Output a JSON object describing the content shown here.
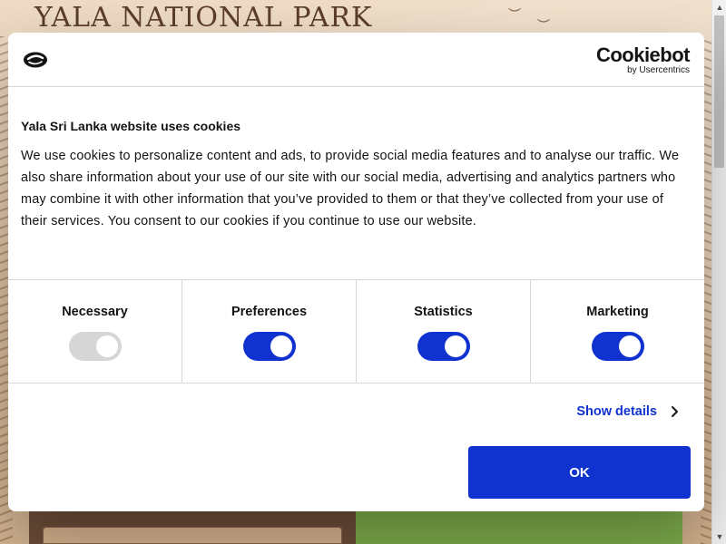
{
  "background": {
    "site_title": "YALA NATIONAL PARK"
  },
  "dialog": {
    "brand": {
      "name": "Cookiebot",
      "byline": "by Usercentrics"
    },
    "title": "Yala Sri Lanka website uses cookies",
    "body": "We use cookies to personalize content and ads, to provide social media features and to analyse our traffic. We also share information about your use of our site with our social media, advertising and analytics partners who may combine it with other information that you’ve provided to them or that they’ve collected from your use of their services. You consent to our cookies if you continue to use our website.",
    "categories": [
      {
        "label": "Necessary",
        "enabled": true,
        "disabled": true
      },
      {
        "label": "Preferences",
        "enabled": true,
        "disabled": false
      },
      {
        "label": "Statistics",
        "enabled": true,
        "disabled": false
      },
      {
        "label": "Marketing",
        "enabled": true,
        "disabled": false
      }
    ],
    "show_details_label": "Show details",
    "ok_label": "OK"
  },
  "colors": {
    "accent": "#1032cf",
    "toggle_disabled": "#d6d6d6",
    "text": "#141414"
  },
  "icons": {
    "site_logo": "cookie-logo-icon",
    "chevron": "chevron-right-icon",
    "scroll_up": "scroll-up-arrow-icon",
    "scroll_down": "scroll-down-arrow-icon"
  }
}
